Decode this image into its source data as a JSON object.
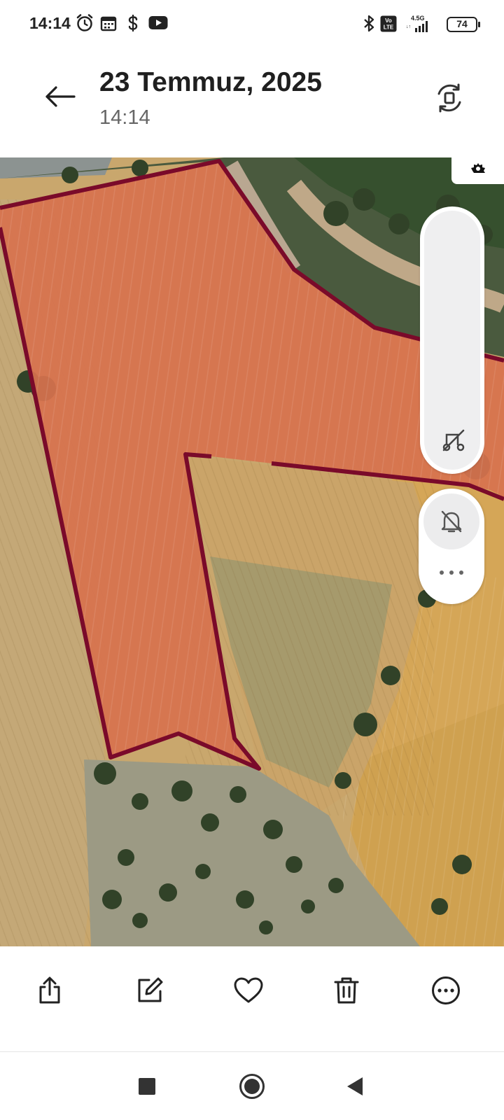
{
  "status_bar": {
    "time": "14:14",
    "icons": [
      "alarm-icon",
      "calendar-icon",
      "dollar-icon",
      "youtube-icon",
      "bluetooth-icon",
      "volte-icon",
      "signal-icon"
    ],
    "network": "4.5G",
    "battery": "74"
  },
  "header": {
    "date": "23 Temmuz, 2025",
    "time": "14:14",
    "back_icon": "arrow-left-icon",
    "rotate_icon": "rotate-screen-icon"
  },
  "photo": {
    "description_colors": {
      "field_overlay": "#d77050",
      "boundary": "#7a0a2a"
    }
  },
  "map_controls": {
    "settings_icon": "gear-icon",
    "route_icon": "route-off-icon",
    "mute_icon": "bell-off-icon",
    "more_icon": "more-horizontal-icon"
  },
  "toolbar": {
    "items": [
      "share-icon",
      "edit-icon",
      "favorite-icon",
      "delete-icon",
      "more-icon"
    ]
  },
  "navigation": {
    "items": [
      "recents-icon",
      "home-icon",
      "back-icon"
    ]
  }
}
